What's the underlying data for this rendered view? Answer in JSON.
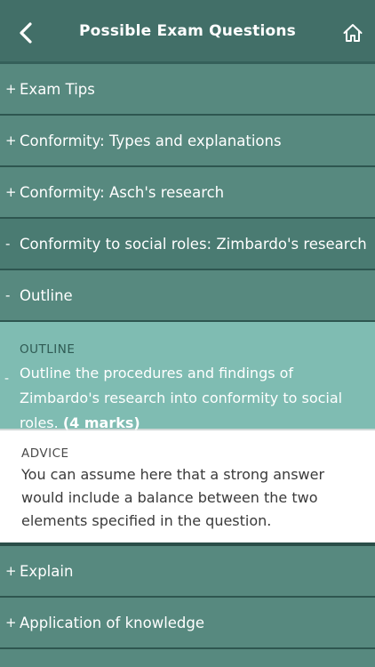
{
  "header": {
    "title": "Possible Exam Questions"
  },
  "rows": [
    {
      "sign": "+",
      "label": "Exam Tips"
    },
    {
      "sign": "+",
      "label": "Conformity: Types and explanations"
    },
    {
      "sign": "+",
      "label": "Conformity: Asch's research"
    },
    {
      "sign": "-",
      "label": "Conformity to social roles: Zimbardo's research"
    },
    {
      "sign": "-",
      "label": "Outline"
    }
  ],
  "question": {
    "kicker": "OUTLINE",
    "sign": "-",
    "text": "Outline the procedures and findings of Zimbardo's research into conformity to social roles.",
    "marks": "(4 marks)"
  },
  "advice": {
    "kicker": "ADVICE",
    "text": "You can assume here that a strong answer would include a balance between the two elements specified in the question."
  },
  "rows_after": [
    {
      "sign": "+",
      "label": "Explain"
    },
    {
      "sign": "+",
      "label": "Application of knowledge"
    }
  ]
}
